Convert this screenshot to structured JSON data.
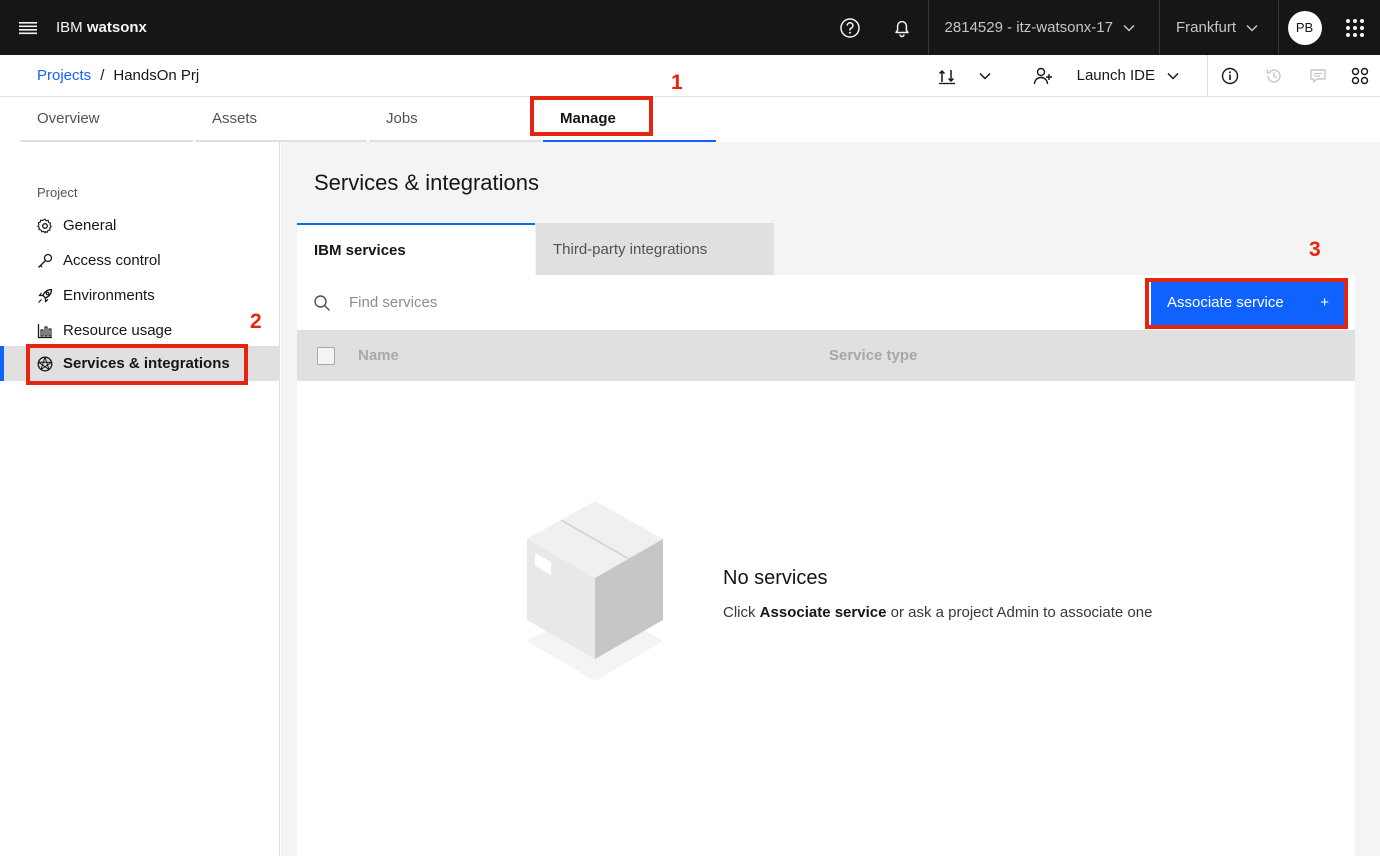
{
  "topbar": {
    "brand_prefix": "IBM",
    "brand_name": "watsonx",
    "account": "2814529 - itz-watsonx-17",
    "region": "Frankfurt",
    "avatar_initials": "PB"
  },
  "breadcrumb": {
    "parent": "Projects",
    "separator": "/",
    "current": "HandsOn Prj"
  },
  "toolbar": {
    "launch_ide": "Launch IDE"
  },
  "tabs": [
    {
      "label": "Overview"
    },
    {
      "label": "Assets"
    },
    {
      "label": "Jobs"
    },
    {
      "label": "Manage"
    }
  ],
  "sidebar": {
    "heading": "Project",
    "items": [
      {
        "label": "General",
        "icon": "gear-icon"
      },
      {
        "label": "Access control",
        "icon": "key-icon"
      },
      {
        "label": "Environments",
        "icon": "rocket-icon"
      },
      {
        "label": "Resource usage",
        "icon": "bar-chart-icon"
      },
      {
        "label": "Services & integrations",
        "icon": "integration-icon",
        "active": true
      }
    ]
  },
  "main": {
    "title": "Services & integrations",
    "subtabs": [
      {
        "label": "IBM services",
        "active": true
      },
      {
        "label": "Third-party integrations"
      }
    ],
    "search_placeholder": "Find services",
    "associate_button": "Associate service",
    "associate_button_icon": "+",
    "columns": [
      "Name",
      "Service type"
    ],
    "empty": {
      "title": "No services",
      "desc_prefix": "Click",
      "desc_bold": "Associate service",
      "desc_suffix": "or ask a project Admin to associate one"
    }
  },
  "annotations": [
    "1",
    "2",
    "3"
  ],
  "colors": {
    "accent": "#0f62fe",
    "annotation": "#e32512",
    "topbar": "#161616"
  }
}
